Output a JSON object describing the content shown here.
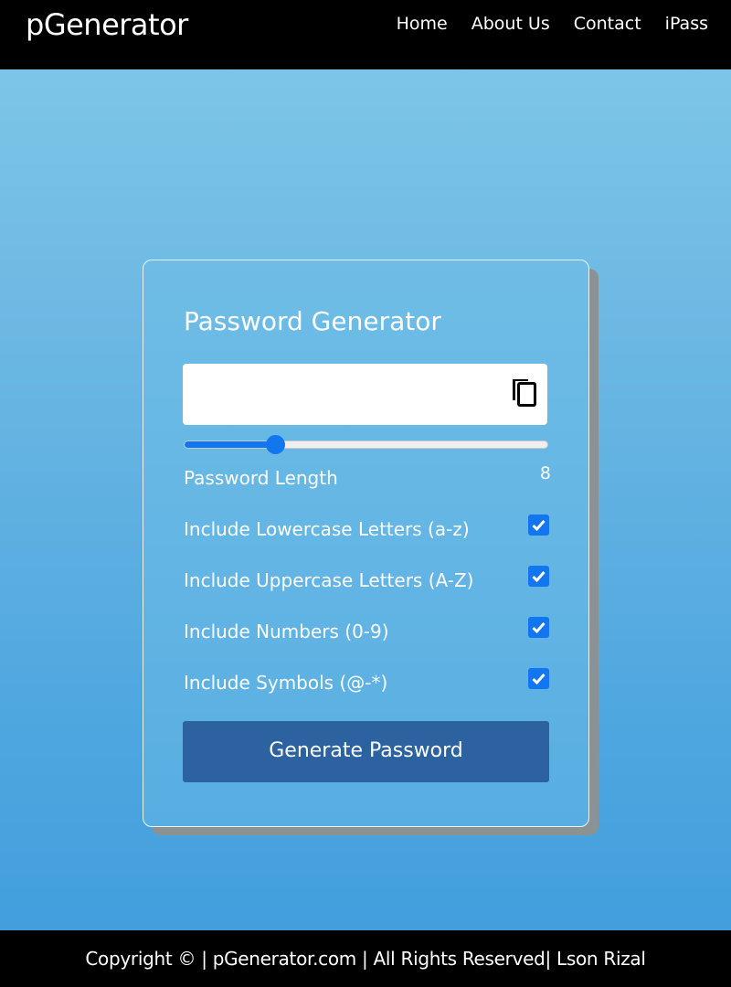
{
  "navbar": {
    "brand": "pGenerator",
    "links": [
      "Home",
      "About Us",
      "Contact",
      "iPass"
    ]
  },
  "card": {
    "title": "Password Generator",
    "result": {
      "value": "",
      "copy_icon": "copy-icon"
    },
    "length": {
      "label": "Password Length",
      "value": "8",
      "slider_fraction": 0.25
    },
    "options": [
      {
        "label": "Include Lowercase Letters (a-z)",
        "checked": true
      },
      {
        "label": "Include Uppercase Letters (A-Z)",
        "checked": true
      },
      {
        "label": "Include Numbers (0-9)",
        "checked": true
      },
      {
        "label": "Include Symbols (@-*)",
        "checked": true
      }
    ],
    "generate_label": "Generate Password"
  },
  "footer": {
    "text": "Copyright © | pGenerator.com | All Rights Reserved| Lson Rizal"
  },
  "colors": {
    "accent": "#1276f0",
    "button": "#2d62a1",
    "nav_bg": "#000000"
  }
}
